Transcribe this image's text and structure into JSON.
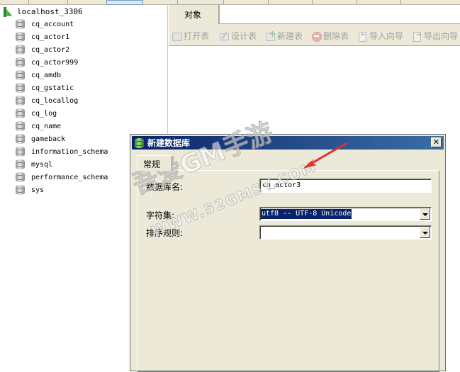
{
  "tree": {
    "connection": "localhost_3306",
    "databases": [
      "cq_account",
      "cq_actor1",
      "cq_actor2",
      "cq_actor999",
      "cq_amdb",
      "cq_gstatic",
      "cq_locallog",
      "cq_log",
      "cq_name",
      "gameback",
      "information_schema",
      "mysql",
      "performance_schema",
      "sys"
    ]
  },
  "objects_tab": {
    "label": "对象"
  },
  "toolbar": {
    "open_table": "打开表",
    "design_table": "设计表",
    "new_table": "新建表",
    "delete_table": "删除表",
    "import_wizard": "导入向导",
    "export_wizard": "导出向导"
  },
  "dialog": {
    "title": "新建数据库",
    "close": "✕",
    "tab_general": "常规",
    "db_name_label": "数据库名:",
    "db_name_value": "cq_actor3",
    "charset_label": "字符集:",
    "charset_value": "utf8 -- UTF-8 Unicode",
    "collation_label": "排序规则:",
    "collation_value": ""
  },
  "watermark": {
    "line1": "吾爱GM手游",
    "line2": "WWW.52GMSY.COM"
  },
  "colors": {
    "titlebar": "#0a246a",
    "selection": "#0a246a",
    "arrow": "#e23030"
  }
}
